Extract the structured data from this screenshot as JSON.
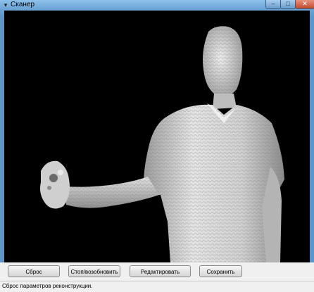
{
  "window": {
    "title": "Сканер",
    "controls": {
      "minimize": "–",
      "maximize": "□",
      "close": "✕"
    }
  },
  "viewport": {
    "content": "3d-reconstruction-mesh",
    "background": "#000000"
  },
  "buttons": {
    "reset": "Сброс",
    "stop_resume": "Стоп/возобновить",
    "edit": "Редактировать",
    "save": "Сохранить"
  },
  "status": {
    "text": "Сброс параметров реконструкции."
  },
  "colors": {
    "mesh": "#d9d9d9",
    "titlebar": "#6aa2d4"
  }
}
